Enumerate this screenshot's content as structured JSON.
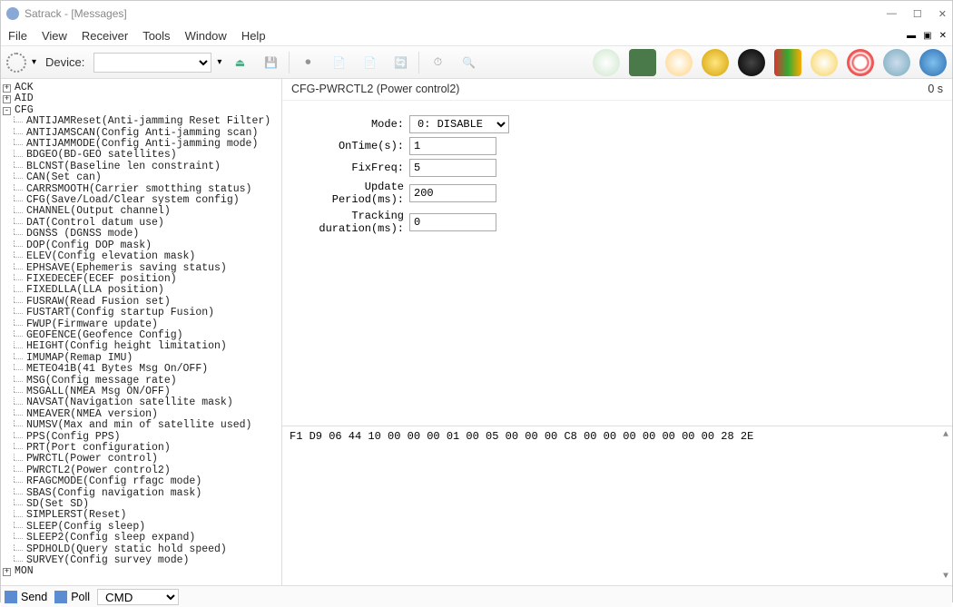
{
  "window": {
    "title": "Satrack - [Messages]",
    "timer": "0 s"
  },
  "menubar": [
    "File",
    "View",
    "Receiver",
    "Tools",
    "Window",
    "Help"
  ],
  "toolbar": {
    "device_label": "Device:"
  },
  "tree": {
    "roots": [
      "ACK",
      "AID",
      "CFG",
      "MON"
    ],
    "cfg_children": [
      "ANTIJAMReset(Anti-jamming Reset Filter)",
      "ANTIJAMSCAN(Config Anti-jamming scan)",
      "ANTIJAMMODE(Config Anti-jamming mode)",
      "BDGEO(BD-GEO satellites)",
      "BLCNST(Baseline len constraint)",
      "CAN(Set can)",
      "CARRSMOOTH(Carrier smotthing status)",
      "CFG(Save/Load/Clear system config)",
      "CHANNEL(Output channel)",
      "DAT(Control datum use)",
      "DGNSS (DGNSS mode)",
      "DOP(Config DOP mask)",
      "ELEV(Config elevation mask)",
      "EPHSAVE(Ephemeris saving status)",
      "FIXEDECEF(ECEF position)",
      "FIXEDLLA(LLA position)",
      "FUSRAW(Read Fusion set)",
      "FUSTART(Config startup Fusion)",
      "FWUP(Firmware update)",
      "GEOFENCE(Geofence Config)",
      "HEIGHT(Config height limitation)",
      "IMUMAP(Remap IMU)",
      "METEO41B(41 Bytes Msg On/OFF)",
      "MSG(Config message rate)",
      "MSGALL(NMEA Msg ON/OFF)",
      "NAVSAT(Navigation satellite mask)",
      "NMEAVER(NMEA version)",
      "NUMSV(Max and min of satellite used)",
      "PPS(Config PPS)",
      "PRT(Port configuration)",
      "PWRCTL(Power control)",
      "PWRCTL2(Power control2)",
      "RFAGCMODE(Config rfagc mode)",
      "SBAS(Config navigation mask)",
      "SD(Set SD)",
      "SIMPLERST(Reset)",
      "SLEEP(Config sleep)",
      "SLEEP2(Config sleep expand)",
      "SPDHOLD(Query static hold speed)",
      "SURVEY(Config survey mode)"
    ]
  },
  "content": {
    "title": "CFG-PWRCTL2 (Power control2)",
    "fields": {
      "mode_label": "Mode:",
      "mode_value": "0: DISABLE",
      "ontime_label": "OnTime(s):",
      "ontime_value": "1",
      "fixfreq_label": "FixFreq:",
      "fixfreq_value": "5",
      "update_label": "Update Period(ms):",
      "update_value": "200",
      "tracking_label": "Tracking duration(ms):",
      "tracking_value": "0"
    },
    "hex": "F1 D9 06 44 10 00 00 00 01 00 05 00 00 00 C8 00 00 00 00 00 00 00 28 2E"
  },
  "statusbar": {
    "send": "Send",
    "poll": "Poll",
    "cmd": "CMD"
  }
}
